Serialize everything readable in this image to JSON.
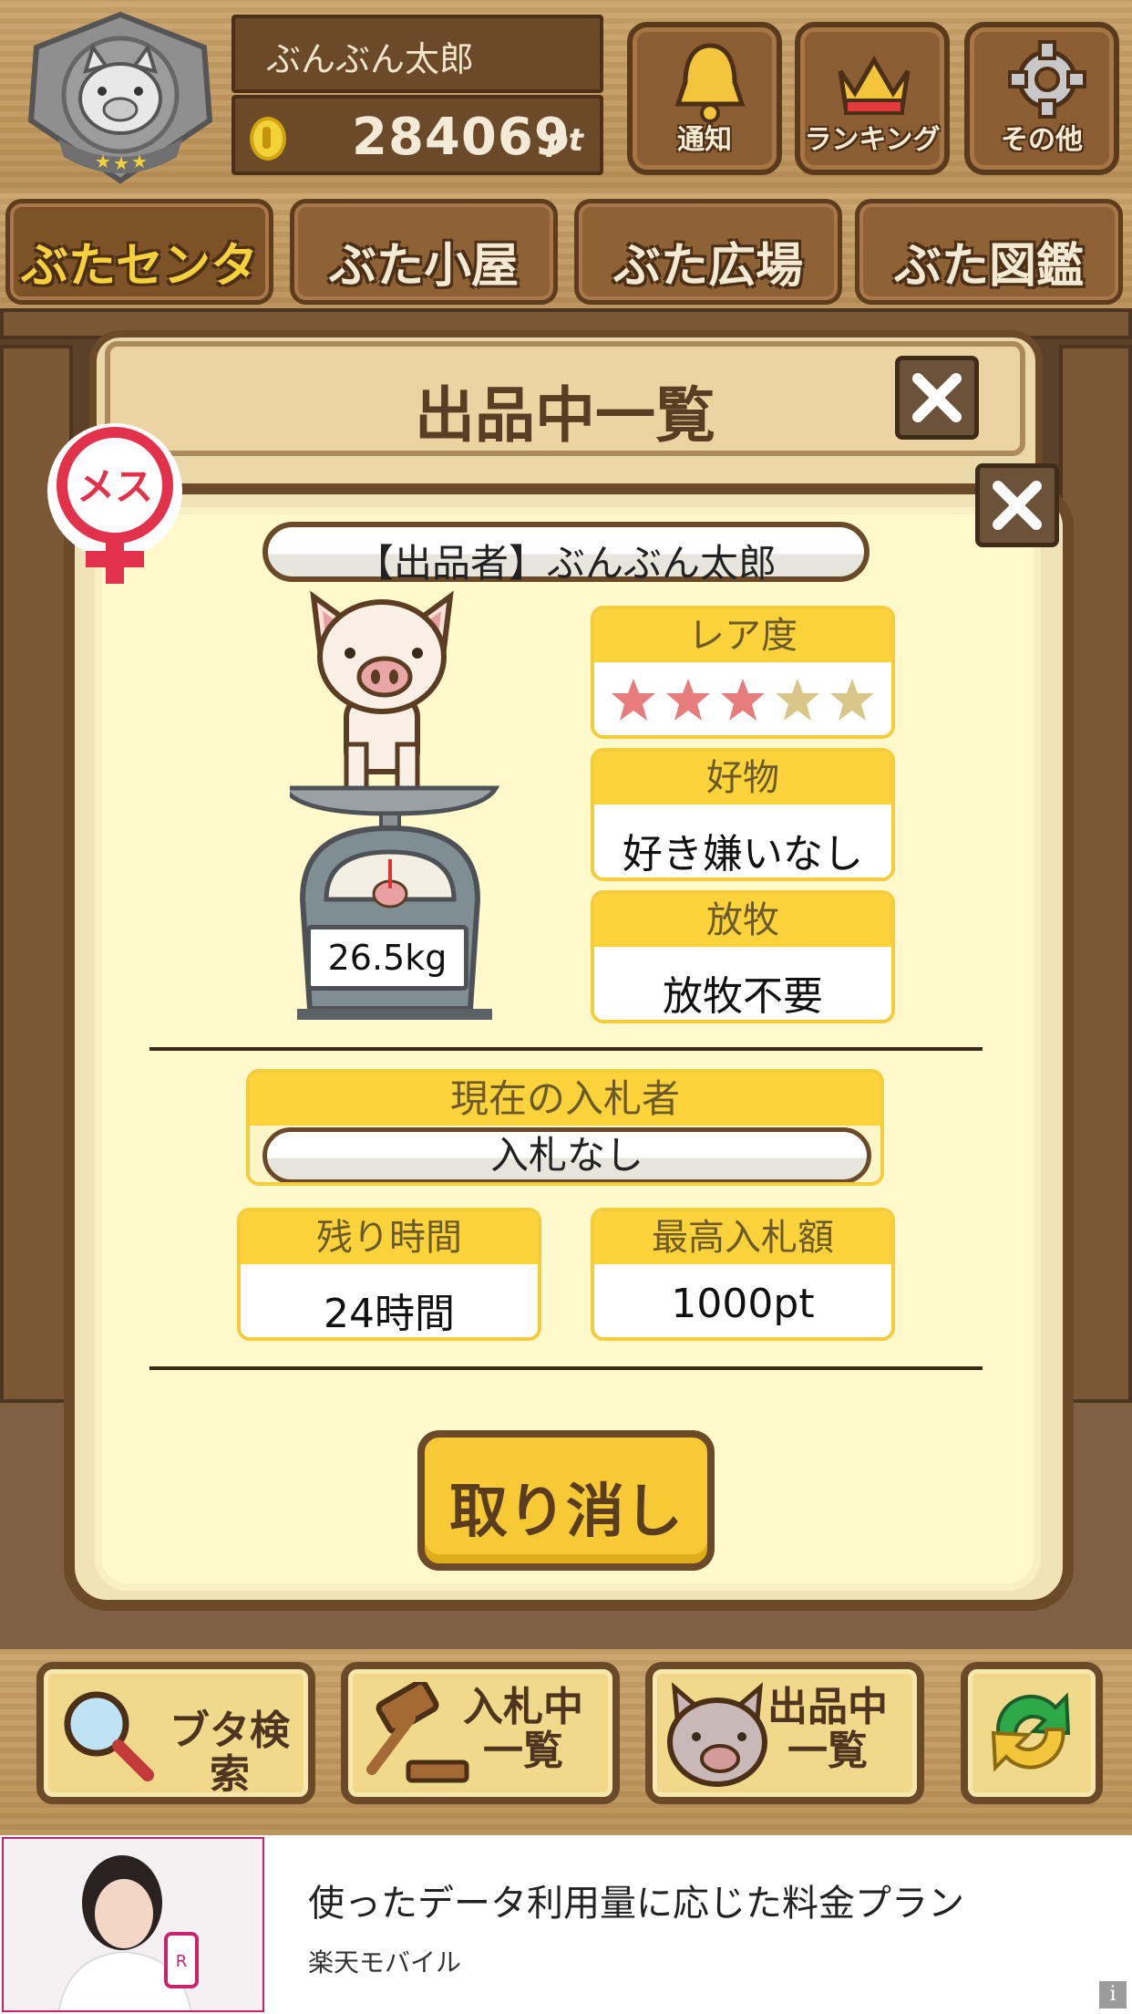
{
  "header": {
    "username": "ぶんぶん太郎",
    "points": "284069",
    "points_unit": "pt",
    "buttons": [
      {
        "label": "通知",
        "icon": "bell-icon"
      },
      {
        "label": "ランキング",
        "icon": "crown-icon"
      },
      {
        "label": "その他",
        "icon": "gear-icon"
      }
    ]
  },
  "tabs": [
    {
      "label": "ぶたセンター",
      "active": true
    },
    {
      "label": "ぶた小屋",
      "active": false
    },
    {
      "label": "ぶた広場",
      "active": false
    },
    {
      "label": "ぶた図鑑",
      "active": false
    }
  ],
  "list_panel": {
    "title": "出品中一覧"
  },
  "dialog": {
    "gender_badge": "メス",
    "seller": "【出品者】ぶんぶん太郎",
    "weight": "26.5kg",
    "rarity": {
      "label": "レア度",
      "value": 3,
      "max": 5
    },
    "favorite": {
      "label": "好物",
      "value": "好き嫌いなし"
    },
    "grazing": {
      "label": "放牧",
      "value": "放牧不要"
    },
    "current_bidder": {
      "label": "現在の入札者",
      "value": "入札なし"
    },
    "time_left": {
      "label": "残り時間",
      "value": "24時間"
    },
    "highest_bid": {
      "label": "最高入札額",
      "value": "1000pt"
    },
    "cancel_button": "取り消し"
  },
  "bottom_bar": [
    {
      "label": "ブタ検索",
      "icon": "magnifier-icon"
    },
    {
      "label": "入札中\n一覧",
      "icon": "gavel-icon"
    },
    {
      "label": "出品中\n一覧",
      "icon": "pig-face-icon"
    },
    {
      "label": "",
      "icon": "refresh-icon"
    }
  ],
  "ad": {
    "title": "使ったデータ利用量に応じた料金プラン",
    "sponsor": "楽天モバイル",
    "info": "i"
  },
  "colors": {
    "wood_dark": "#6b4a2a",
    "panel_cream": "#fff9cc",
    "label_yellow": "#fcd33a",
    "star_on": "#e77c7c",
    "star_off": "#d9c689",
    "active_tab_text": "#f6d13b"
  }
}
